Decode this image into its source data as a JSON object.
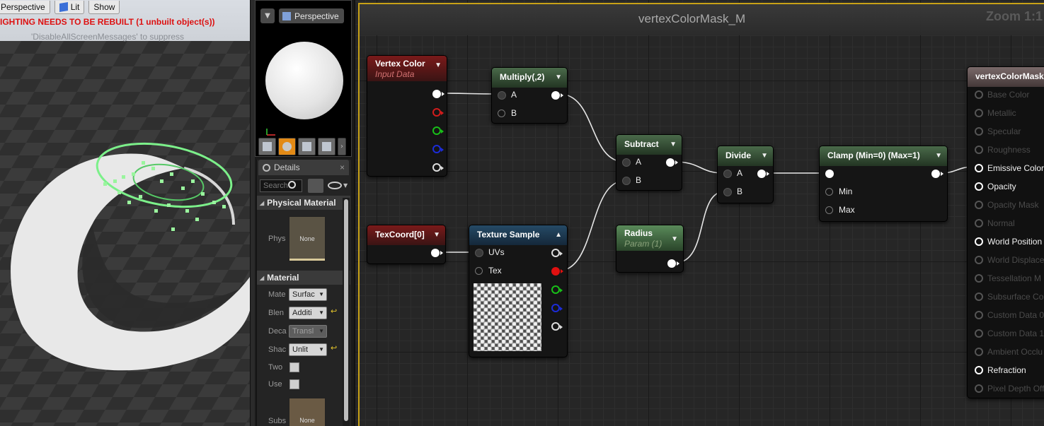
{
  "viewport": {
    "buttons": {
      "perspective": "Perspective",
      "lit": "Lit",
      "show": "Show"
    },
    "warning": "IGHTING NEEDS TO BE REBUILT (1 unbuilt object(s))",
    "suppress_hint": "'DisableAllScreenMessages' to suppress"
  },
  "preview": {
    "perspective_label": "Perspective"
  },
  "details": {
    "tab_title": "Details",
    "search_placeholder": "Search",
    "sections": {
      "physical_material": "Physical Material",
      "material": "Material"
    },
    "physical": {
      "label": "Phys",
      "thumb": "None"
    },
    "material_rows": {
      "material_domain": {
        "label": "Mate",
        "value": "Surfac"
      },
      "blend_mode": {
        "label": "Blen",
        "value": "Additi"
      },
      "decal_blend": {
        "label": "Deca",
        "value": "Transl"
      },
      "shading_model": {
        "label": "Shac",
        "value": "Unlit"
      },
      "two_sided": {
        "label": "Two"
      },
      "use": {
        "label": "Use"
      },
      "subsurface": {
        "label": "Subs",
        "thumb": "None"
      }
    }
  },
  "graph": {
    "title": "vertexColorMask_M",
    "zoom": "Zoom 1:1",
    "nodes": {
      "vertex_color": {
        "title": "Vertex Color",
        "subtitle": "Input Data"
      },
      "multiply": {
        "title": "Multiply(,2)",
        "pin_a": "A",
        "pin_b": "B"
      },
      "texcoord": {
        "title": "TexCoord[0]"
      },
      "texture_sample": {
        "title": "Texture Sample",
        "pin_uvs": "UVs",
        "pin_tex": "Tex"
      },
      "subtract": {
        "title": "Subtract",
        "pin_a": "A",
        "pin_b": "B"
      },
      "radius": {
        "title": "Radius",
        "subtitle": "Param (1)"
      },
      "divide": {
        "title": "Divide",
        "pin_a": "A",
        "pin_b": "B"
      },
      "clamp": {
        "title": "Clamp (Min=0) (Max=1)",
        "pin_min": "Min",
        "pin_max": "Max"
      },
      "result": {
        "title": "vertexColorMask",
        "inputs": [
          {
            "label": "Base Color",
            "active": false
          },
          {
            "label": "Metallic",
            "active": false
          },
          {
            "label": "Specular",
            "active": false
          },
          {
            "label": "Roughness",
            "active": false
          },
          {
            "label": "Emissive Color",
            "active": true
          },
          {
            "label": "Opacity",
            "active": true
          },
          {
            "label": "Opacity Mask",
            "active": false
          },
          {
            "label": "Normal",
            "active": false
          },
          {
            "label": "World Position",
            "active": true
          },
          {
            "label": "World Displace",
            "active": false
          },
          {
            "label": "Tessellation M",
            "active": false
          },
          {
            "label": "Subsurface Co",
            "active": false
          },
          {
            "label": "Custom Data 0",
            "active": false
          },
          {
            "label": "Custom Data 1",
            "active": false
          },
          {
            "label": "Ambient Occlu",
            "active": false
          },
          {
            "label": "Refraction",
            "active": true
          },
          {
            "label": "Pixel Depth Off",
            "active": false
          }
        ]
      }
    }
  }
}
